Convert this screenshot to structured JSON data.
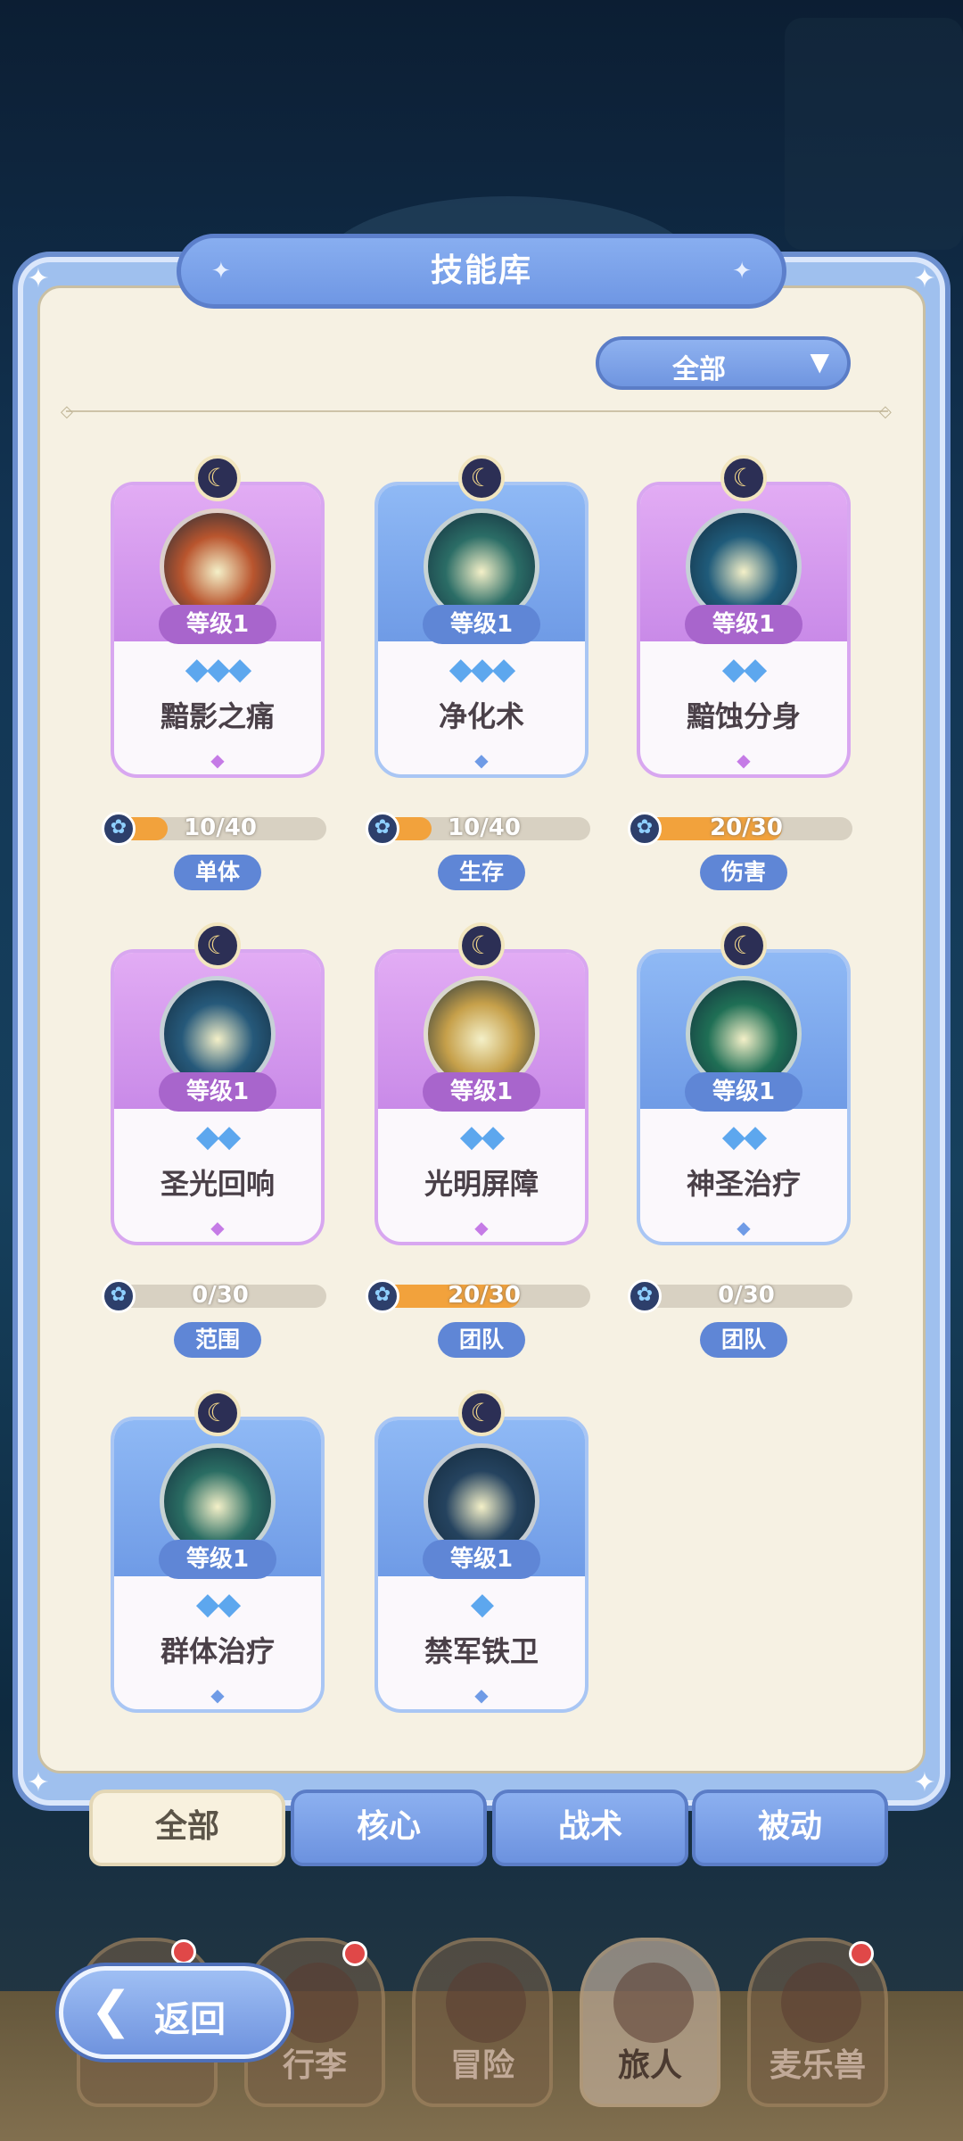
{
  "panel": {
    "title": "技能库",
    "filter_label": "全部",
    "filter_arrow": "▼"
  },
  "skills": [
    {
      "name": "黯影之痛",
      "level": "等级1",
      "stars": "◆◆◆",
      "progress_text": "10/40",
      "progress": 0.25,
      "tag": "单体",
      "theme": "purple",
      "icon": "shadow-pain-icon",
      "icon_color": "#b9552e"
    },
    {
      "name": "净化术",
      "level": "等级1",
      "stars": "◆◆◆",
      "progress_text": "10/40",
      "progress": 0.25,
      "tag": "生存",
      "theme": "blue",
      "icon": "purify-icon",
      "icon_color": "#2b6d66"
    },
    {
      "name": "黯蚀分身",
      "level": "等级1",
      "stars": "◆◆",
      "progress_text": "20/30",
      "progress": 0.67,
      "tag": "伤害",
      "theme": "purple",
      "icon": "shadow-clone-icon",
      "icon_color": "#1f5b7a"
    },
    {
      "name": "圣光回响",
      "level": "等级1",
      "stars": "◆◆",
      "progress_text": "0/30",
      "progress": 0,
      "tag": "范围",
      "theme": "purple",
      "icon": "holy-echo-icon",
      "icon_color": "#26597a"
    },
    {
      "name": "光明屏障",
      "level": "等级1",
      "stars": "◆◆",
      "progress_text": "20/30",
      "progress": 0.67,
      "tag": "团队",
      "theme": "purple",
      "icon": "light-barrier-icon",
      "icon_color": "#c6a04a"
    },
    {
      "name": "神圣治疗",
      "level": "等级1",
      "stars": "◆◆",
      "progress_text": "0/30",
      "progress": 0,
      "tag": "团队",
      "theme": "blue",
      "icon": "holy-heal-icon",
      "icon_color": "#1f6f55"
    },
    {
      "name": "群体治疗",
      "level": "等级1",
      "stars": "◆◆",
      "progress_text": "",
      "progress": null,
      "tag": "",
      "theme": "blue",
      "icon": "mass-heal-icon",
      "icon_color": "#2a6d63"
    },
    {
      "name": "禁军铁卫",
      "level": "等级1",
      "stars": "◆",
      "progress_text": "",
      "progress": null,
      "tag": "",
      "theme": "blue",
      "icon": "royal-guard-icon",
      "icon_color": "#25435f"
    }
  ],
  "tabs": [
    {
      "label": "全部",
      "active": true
    },
    {
      "label": "核心",
      "active": false
    },
    {
      "label": "战术",
      "active": false
    },
    {
      "label": "被动",
      "active": false
    }
  ],
  "bottom_nav": [
    {
      "label": "",
      "badge": true
    },
    {
      "label": "行李",
      "badge": true
    },
    {
      "label": "冒险",
      "badge": false
    },
    {
      "label": "旅人",
      "badge": false,
      "active": true
    },
    {
      "label": "麦乐兽",
      "badge": true
    }
  ],
  "back_button": {
    "label": "返回"
  }
}
